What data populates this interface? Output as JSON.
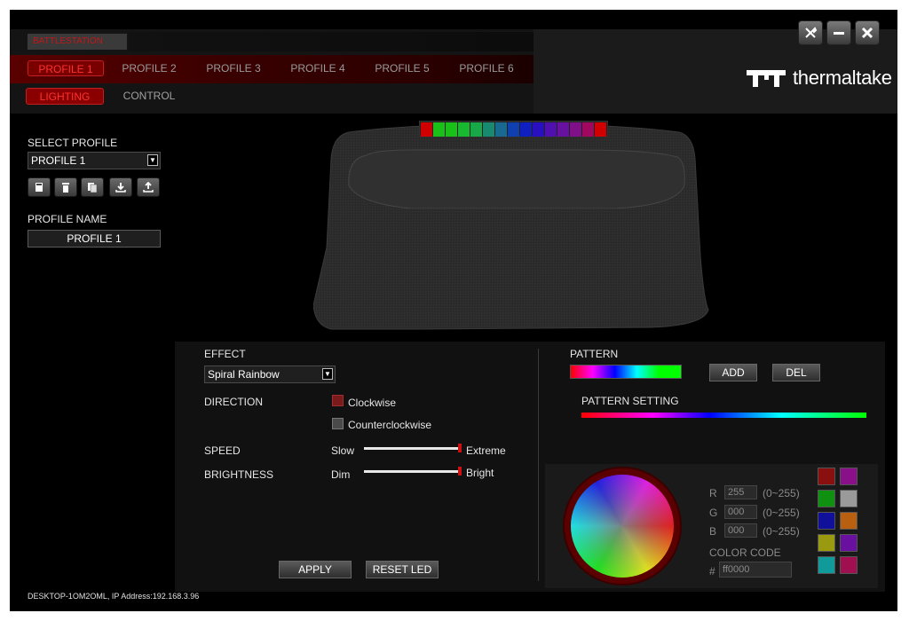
{
  "app": {
    "title": "BATTLESTATION"
  },
  "profiles": [
    "PROFILE 1",
    "PROFILE 2",
    "PROFILE 3",
    "PROFILE 4",
    "PROFILE 5",
    "PROFILE 6"
  ],
  "sub_tabs": {
    "lighting": "LIGHTING",
    "control": "CONTROL"
  },
  "brand": {
    "name": "thermaltake"
  },
  "window_buttons": {
    "tools": "tools-icon",
    "minimize": "minimize-icon",
    "close": "close-icon"
  },
  "left_panel": {
    "select_profile_label": "SELECT PROFILE",
    "select_profile_value": "PROFILE 1",
    "tool_icons": [
      "save-icon",
      "delete-icon",
      "copy-icon",
      "import-icon",
      "export-icon"
    ],
    "profile_name_label": "PROFILE NAME",
    "profile_name_value": "PROFILE 1"
  },
  "led_colors": [
    "#d00000",
    "#18c018",
    "#18c018",
    "#18b830",
    "#18a848",
    "#188a70",
    "#186a90",
    "#1040b0",
    "#1020c0",
    "#2810c0",
    "#5010b0",
    "#6810a0",
    "#801088",
    "#a00860",
    "#d00000"
  ],
  "effect": {
    "label": "EFFECT",
    "value": "Spiral Rainbow",
    "direction_label": "DIRECTION",
    "clockwise": "Clockwise",
    "counterclockwise": "Counterclockwise",
    "speed_label": "SPEED",
    "speed_min": "Slow",
    "speed_max": "Extreme",
    "speed_level": 1.0,
    "brightness_label": "BRIGHTNESS",
    "brightness_min": "Dim",
    "brightness_max": "Bright",
    "brightness_level": 1.0,
    "apply": "APPLY",
    "reset": "RESET LED"
  },
  "pattern": {
    "label": "PATTERN",
    "add": "ADD",
    "del": "DEL",
    "setting_label": "PATTERN SETTING"
  },
  "color": {
    "r_label": "R",
    "r_value": "255",
    "r_range": "(0~255)",
    "g_label": "G",
    "g_value": "000",
    "g_range": "(0~255)",
    "b_label": "B",
    "b_value": "000",
    "b_range": "(0~255)",
    "code_label": "COLOR CODE",
    "hash": "#",
    "code_value": "ff0000",
    "swatches": [
      "#8a1010",
      "#8a108a",
      "#109010",
      "#9a9a9a",
      "#10109a",
      "#b86010",
      "#9a9a10",
      "#6a10a0",
      "#109a9a",
      "#a01050"
    ]
  },
  "footer": {
    "status": "DESKTOP-1OM2OML, IP Address:192.168.3.96"
  }
}
